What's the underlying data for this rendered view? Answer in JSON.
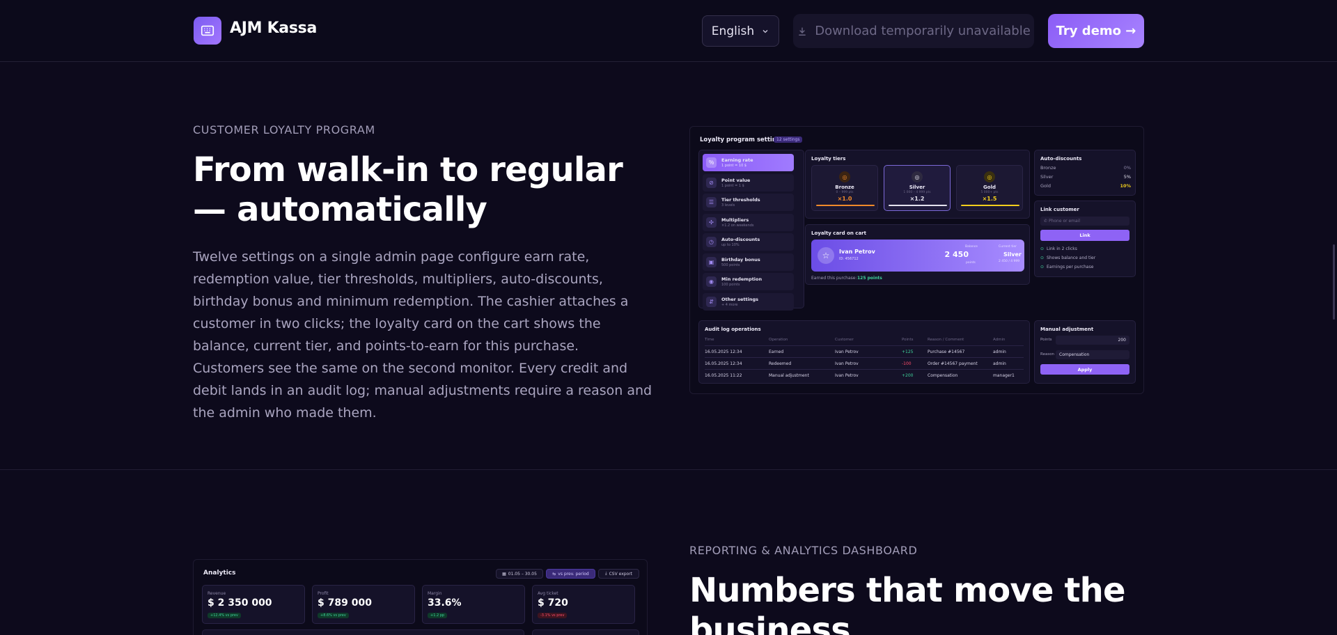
{
  "header": {
    "brand": "AJM Kassa",
    "language": "English",
    "download_label": "Download temporarily unavailable",
    "demo_label": "Try demo →"
  },
  "loyalty_section": {
    "eyebrow": "CUSTOMER LOYALTY PROGRAM",
    "title": "From walk-in to regular — automatically",
    "description": "Twelve settings on a single admin page configure earn rate, redemption value, tier thresholds, multipliers, auto-discounts, birthday bonus and minimum redemption. The cashier attaches a customer in two clicks; the loyalty card on the cart shows the balance, current tier, and points-to-earn for this purchase. Customers see the same on the second monitor. Every credit and debit lands in an audit log; manual adjustments require a reason and the admin who made them."
  },
  "loyalty_mock": {
    "title": "Loyalty program settings",
    "badge": "12 settings",
    "settings": [
      {
        "label": "Earning rate",
        "sub": "1 point = 10 $",
        "active": true
      },
      {
        "label": "Point value",
        "sub": "1 point = 1 $"
      },
      {
        "label": "Tier thresholds",
        "sub": "3 levels"
      },
      {
        "label": "Multipliers",
        "sub": "×1.2 on weekends"
      },
      {
        "label": "Auto-discounts",
        "sub": "up to 10%"
      },
      {
        "label": "Birthday bonus",
        "sub": "500 points"
      },
      {
        "label": "Min redemption",
        "sub": "100 points"
      },
      {
        "label": "Other settings",
        "sub": "+ 4 more"
      }
    ],
    "tiers_title": "Loyalty tiers",
    "tiers": [
      {
        "name": "Bronze",
        "range": "0 – 999 pts",
        "mult": "×1.0",
        "color": "#f08a2a"
      },
      {
        "name": "Silver",
        "range": "1 000 – 4 999 pts",
        "mult": "×1.2",
        "color": "#e4e2ee"
      },
      {
        "name": "Gold",
        "range": "5 000+ pts",
        "mult": "×1.5",
        "color": "#f3cf1c"
      }
    ],
    "auto_title": "Auto-discounts",
    "auto": [
      {
        "tier": "Bronze",
        "value": "0%"
      },
      {
        "tier": "Silver",
        "value": "5%"
      },
      {
        "tier": "Gold",
        "value": "10%"
      }
    ],
    "card_title": "Loyalty card on cart",
    "card_name": "Ivan Petrov",
    "card_id": "ID: 456712",
    "card_balance_label": "Balance",
    "card_balance": "2 450",
    "card_points": "points",
    "card_tier_label": "Current tier",
    "card_tier": "Silver",
    "card_tier_sub": "2 450 / 4 999",
    "earned_label": "Earned this purchase:",
    "earned_value": "125 points",
    "link_title": "Link customer",
    "link_placeholder": "Phone or email",
    "link_button": "Link",
    "link_checks": [
      "Link in 2 clicks",
      "Shows balance and tier",
      "Earnings per purchase"
    ],
    "audit_title": "Audit log operations",
    "audit_headers": [
      "Time",
      "Operation",
      "Customer",
      "Points",
      "Reason / Comment",
      "Admin"
    ],
    "audit_rows": [
      [
        "16.05.2025 12:34",
        "Earned",
        "Ivan Petrov",
        "+125",
        "Purchase #14567",
        "admin"
      ],
      [
        "16.05.2025 12:34",
        "Redeemed",
        "Ivan Petrov",
        "-100",
        "Order #14567 payment",
        "admin"
      ],
      [
        "16.05.2025 11:22",
        "Manual adjustment",
        "Ivan Petrov",
        "+200",
        "Compensation",
        "manager1"
      ]
    ],
    "manual_title": "Manual adjustment",
    "manual_points_label": "Points",
    "manual_points": "200",
    "manual_reason_label": "Reason",
    "manual_reason": "Compensation",
    "manual_button": "Apply"
  },
  "analytics_section": {
    "eyebrow": "REPORTING & ANALYTICS DASHBOARD",
    "title": "Numbers that move the business"
  },
  "analytics_mock": {
    "title": "Analytics",
    "date_range": "01.05 – 30.05",
    "compare": "vs prev. period",
    "export": "CSV export",
    "kpis": [
      {
        "label": "Revenue",
        "value": "$ 2 350 000",
        "delta": "+12.4% vs prev",
        "positive": true
      },
      {
        "label": "Profit",
        "value": "$ 789 000",
        "delta": "+8.6% vs prev",
        "positive": true
      },
      {
        "label": "Margin",
        "value": "33.6%",
        "delta": "+1.2 pp",
        "positive": true
      },
      {
        "label": "Avg ticket",
        "value": "$ 720",
        "delta": "-3.1% vs prev",
        "positive": false
      }
    ]
  },
  "colors": {
    "accent": "#8b5cf6",
    "background": "#0d0a1c",
    "positive": "#3fd19a",
    "negative": "#ff4d6a"
  }
}
